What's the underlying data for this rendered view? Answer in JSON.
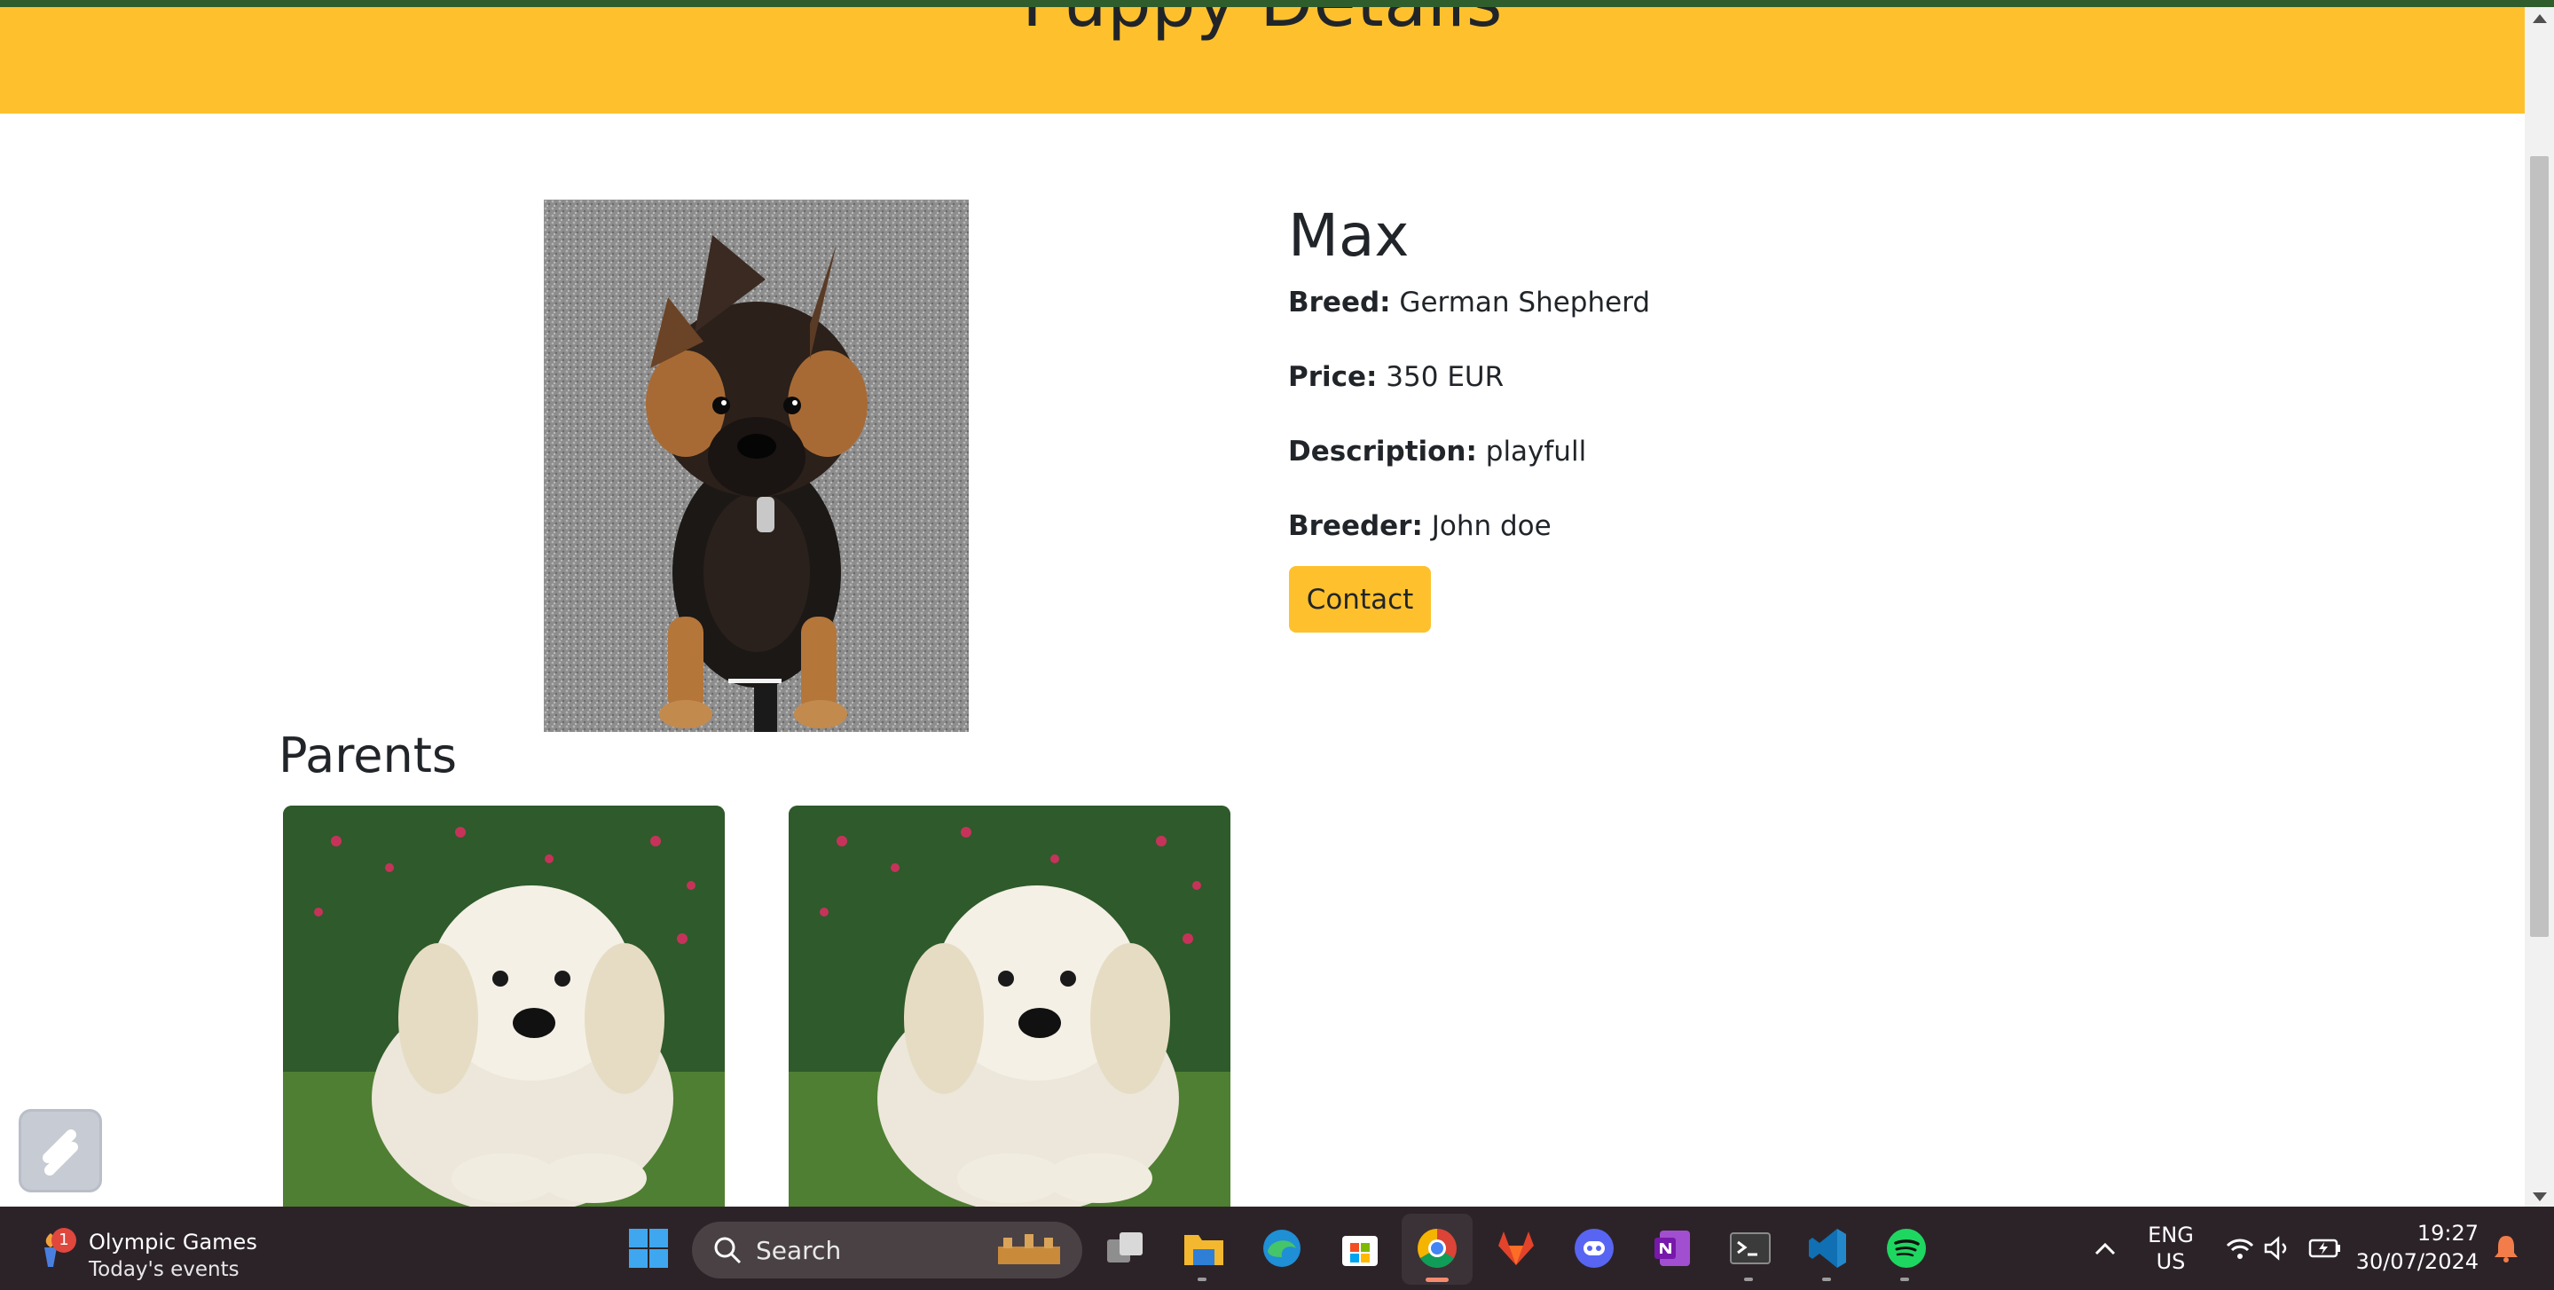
{
  "header": {
    "title": "Puppy Details"
  },
  "puppy": {
    "name": "Max",
    "fields": [
      {
        "label": "Breed:",
        "value": "German Shepherd"
      },
      {
        "label": "Price:",
        "value": "350 EUR"
      },
      {
        "label": "Description:",
        "value": "playfull"
      },
      {
        "label": "Breeder:",
        "value": "John doe"
      }
    ],
    "contact_label": "Contact",
    "photo_icon": "german-shepherd-puppy-photo"
  },
  "parents": {
    "title": "Parents",
    "photo_icon": "golden-retriever-puppy-photo"
  },
  "taskbar": {
    "weather_title": "Olympic Games",
    "weather_sub": "Today's events",
    "weather_badge": "1",
    "search_placeholder": "Search",
    "lang1": "ENG",
    "lang2": "US",
    "time": "19:27",
    "date": "30/07/2024"
  },
  "colors": {
    "accent": "#fec12d",
    "taskbar": "#2c2328",
    "text": "#212529"
  }
}
